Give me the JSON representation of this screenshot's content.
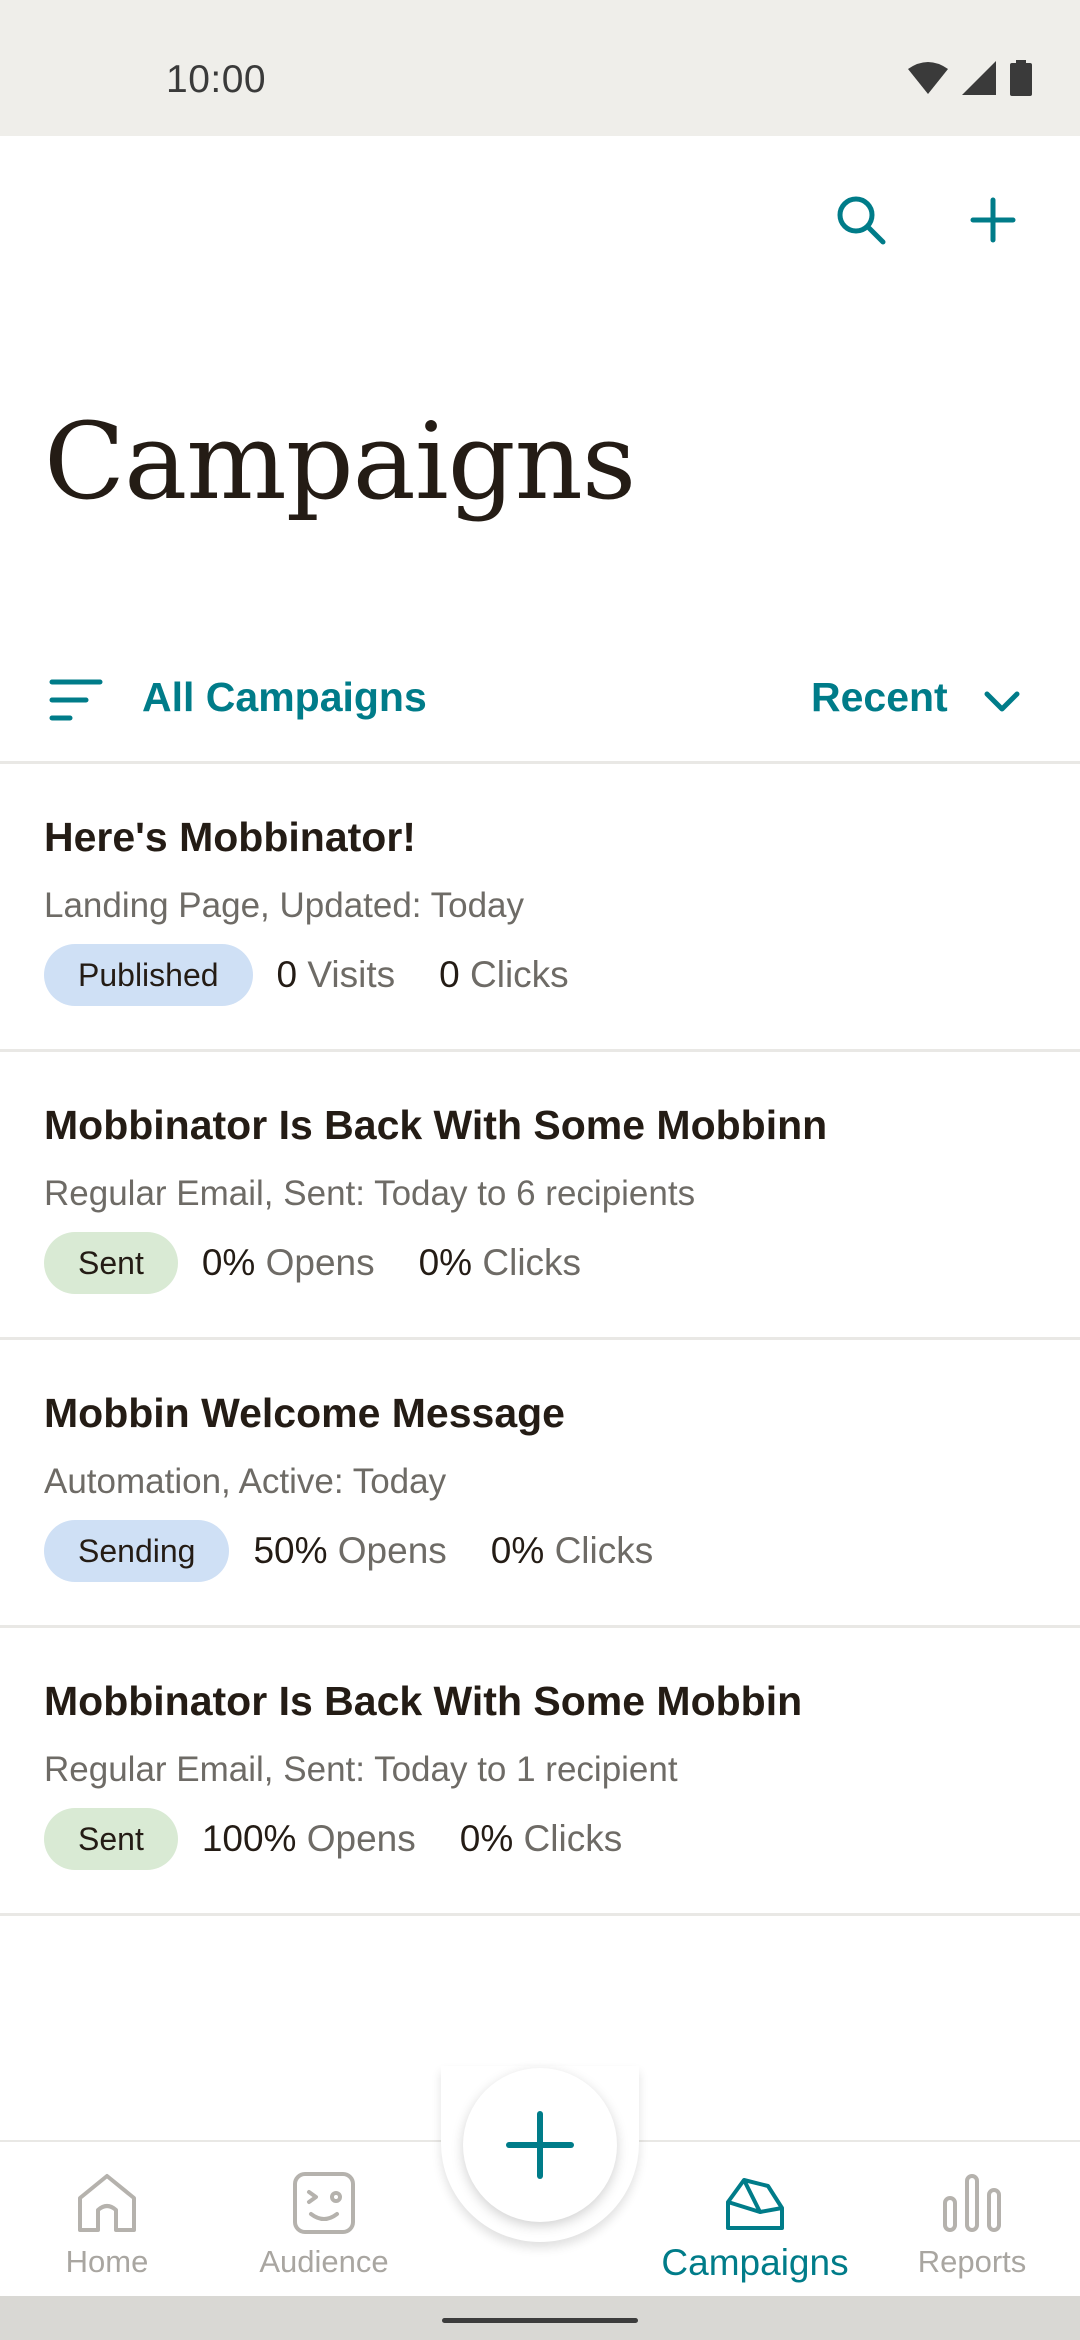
{
  "status_bar": {
    "time": "10:00"
  },
  "header": {
    "title": "Campaigns"
  },
  "filter": {
    "label": "All Campaigns",
    "sort_label": "Recent"
  },
  "campaigns": [
    {
      "title": "Here's Mobbinator!",
      "subtitle": "Landing Page, Updated: Today",
      "badge": "Published",
      "stat1_value": "0",
      "stat1_label": "Visits",
      "stat2_value": "0",
      "stat2_label": "Clicks"
    },
    {
      "title": "Mobbinator Is Back With Some Mobbinn",
      "subtitle": "Regular Email, Sent: Today to 6 recipients",
      "badge": "Sent",
      "stat1_value": "0%",
      "stat1_label": "Opens",
      "stat2_value": "0%",
      "stat2_label": "Clicks"
    },
    {
      "title": "Mobbin Welcome Message",
      "subtitle": "Automation, Active: Today",
      "badge": "Sending",
      "stat1_value": "50%",
      "stat1_label": "Opens",
      "stat2_value": "0%",
      "stat2_label": "Clicks"
    },
    {
      "title": "Mobbinator Is Back With Some Mobbin",
      "subtitle": "Regular Email, Sent: Today to 1 recipient",
      "badge": "Sent",
      "stat1_value": "100%",
      "stat1_label": "Opens",
      "stat2_value": "0%",
      "stat2_label": "Clicks"
    }
  ],
  "bottom_nav": {
    "items": [
      {
        "label": "Home",
        "icon": "home-icon",
        "active": false
      },
      {
        "label": "Audience",
        "icon": "audience-icon",
        "active": false
      },
      {
        "label": "Campaigns",
        "icon": "campaigns-icon",
        "active": true
      },
      {
        "label": "Reports",
        "icon": "reports-icon",
        "active": false
      }
    ]
  },
  "colors": {
    "accent": "#007c89",
    "badge_blue": "#cfe0f5",
    "badge_green": "#d9ead4",
    "text_primary": "#241c15",
    "text_secondary": "#6e6b66",
    "nav_inactive": "#a9a6a1"
  }
}
